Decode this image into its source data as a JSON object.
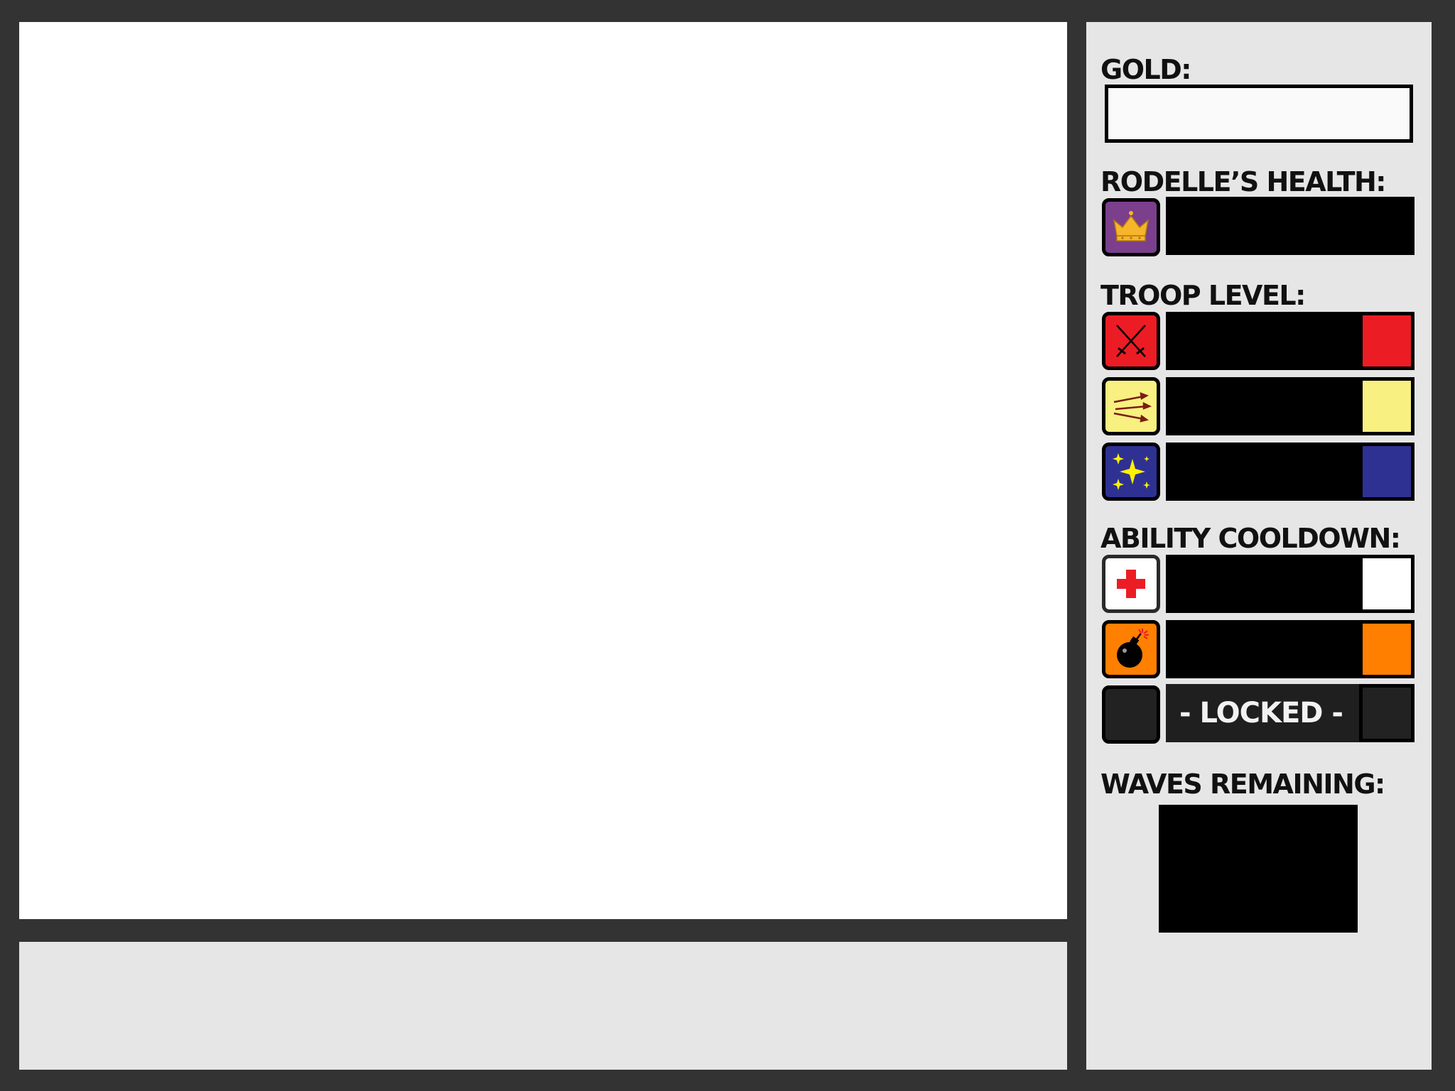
{
  "hud": {
    "gold_label": "GOLD:",
    "gold_value": "",
    "health_label": "RODELLE’S HEALTH:",
    "troop_label": "TROOP LEVEL:",
    "ability_label": "ABILITY COOLDOWN:",
    "waves_label": "WAVES REMAINING:",
    "waves_value": "",
    "locked_text": "- LOCKED -"
  },
  "health": {
    "icon": "crown-icon",
    "color": "#7b3f8c"
  },
  "troops": [
    {
      "name": "swords",
      "icon": "crossed-swords-icon",
      "color": "#ec1c24"
    },
    {
      "name": "arrows",
      "icon": "arrows-icon",
      "color": "#f8f080"
    },
    {
      "name": "magic",
      "icon": "sparkles-icon",
      "color": "#2e3192"
    }
  ],
  "abilities": [
    {
      "name": "heal",
      "icon": "red-cross-icon",
      "color": "#ffffff"
    },
    {
      "name": "bomb",
      "icon": "bomb-icon",
      "color": "#ff7f00"
    },
    {
      "name": "locked",
      "icon": "locked-slot-icon",
      "color": "#222222"
    }
  ]
}
